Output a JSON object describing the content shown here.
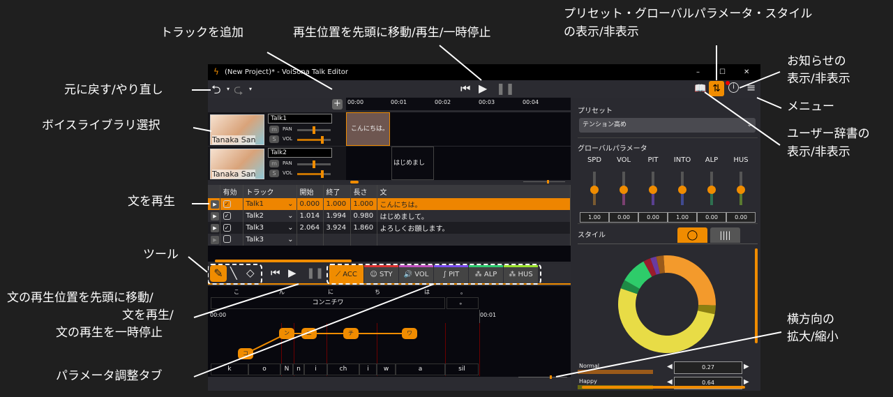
{
  "annotations": {
    "add_track": "トラックを追加",
    "transport": "再生位置を先頭に移動/再生/一時停止",
    "preset_toggle_1": "プリセット・グローバルパラメータ・スタイル",
    "preset_toggle_2": "の表示/非表示",
    "notice_1": "お知らせの",
    "notice_2": "表示/非表示",
    "menu": "メニュー",
    "dict_1": "ユーザー辞書の",
    "dict_2": "表示/非表示",
    "undo_redo": "元に戻す/やり直し",
    "voice_select": "ボイスライブラリ選択",
    "play_sentence": "文を再生",
    "tools": "ツール",
    "sentence_transport_1": "文の再生位置を先頭に移動/",
    "sentence_transport_2": "文を再生/",
    "sentence_transport_3": "文の再生を一時停止",
    "param_tabs": "パラメータ調整タブ",
    "zoom_1": "横方向の",
    "zoom_2": "拡大/縮小"
  },
  "window": {
    "title": "(New Project)* - VoiSona Talk Editor",
    "min": "–",
    "max": "☐",
    "close": "✕"
  },
  "timeline": {
    "ticks": [
      "00:00",
      "00:01",
      "00:02",
      "00:03",
      "00:04"
    ]
  },
  "tracks": [
    {
      "name": "Talk1",
      "voice": "Tanaka San",
      "m": "m",
      "s": "S",
      "pan": "PAN",
      "vol": "VOL",
      "clip": "こんにちは。"
    },
    {
      "name": "Talk2",
      "voice": "Tanaka San",
      "m": "m",
      "s": "S",
      "pan": "PAN",
      "vol": "VOL",
      "clip": "はじめまして。"
    }
  ],
  "table": {
    "headers": [
      "",
      "有効",
      "トラック",
      "開始",
      "終了",
      "長さ",
      "文"
    ],
    "rows": [
      {
        "track": "Talk1",
        "start": "0.000",
        "end": "1.000",
        "len": "1.000",
        "text": "こんにちは。",
        "enabled": true
      },
      {
        "track": "Talk2",
        "start": "1.014",
        "end": "1.994",
        "len": "0.980",
        "text": "はじめまして。",
        "enabled": true
      },
      {
        "track": "Talk3",
        "start": "2.064",
        "end": "3.924",
        "len": "1.860",
        "text": "よろしくお願します。",
        "enabled": true
      },
      {
        "track": "Talk3",
        "start": "",
        "end": "",
        "len": "",
        "text": "",
        "enabled": false
      }
    ]
  },
  "param_tabs": [
    {
      "label": "ACC",
      "color": "#f08c00"
    },
    {
      "label": "STY",
      "color": "#d33"
    },
    {
      "label": "VOL",
      "color": "#c050c0"
    },
    {
      "label": "PIT",
      "color": "#7a4cf0"
    },
    {
      "label": "ALP",
      "color": "#2ecc71"
    },
    {
      "label": "HUS",
      "color": "#9be22d"
    }
  ],
  "editor": {
    "kana": [
      "こ",
      "ん",
      "に",
      "ち",
      "は",
      "。"
    ],
    "reading": "コンニチワ",
    "reading_punct": "。",
    "time": [
      "00:00",
      "00:01"
    ],
    "nodes": [
      "コ",
      "ン",
      "ニ",
      "チ",
      "ワ"
    ],
    "phonemes": [
      "k",
      "o",
      "N",
      "n",
      "i",
      "ch",
      "i",
      "w",
      "a",
      "sil"
    ]
  },
  "right": {
    "preset_title": "プリセット",
    "preset_value": "テンション高め",
    "global_title": "グローバルパラメータ",
    "params": [
      {
        "label": "SPD",
        "value": "1.00",
        "color": "#7a5a30"
      },
      {
        "label": "VOL",
        "value": "0.00",
        "color": "#7a4070"
      },
      {
        "label": "PIT",
        "value": "0.00",
        "color": "#5a4090"
      },
      {
        "label": "INTO",
        "value": "1.00",
        "color": "#404a90"
      },
      {
        "label": "ALP",
        "value": "0.00",
        "color": "#2e7050"
      },
      {
        "label": "HUS",
        "value": "0.00",
        "color": "#5a7a30"
      }
    ],
    "style_title": "スタイル",
    "style_slices": [
      {
        "value": 27,
        "color": "#f39a2c"
      },
      {
        "value": 3,
        "color": "#8c8010"
      },
      {
        "value": 53,
        "color": "#e8dc46"
      },
      {
        "value": 3,
        "color": "#1e8a45"
      },
      {
        "value": 9,
        "color": "#2ecc6a"
      },
      {
        "value": 2.5,
        "color": "#9a1c2c"
      },
      {
        "value": 2,
        "color": "#6a3aa0"
      },
      {
        "value": 2.5,
        "color": "#9a5a1a"
      }
    ],
    "styles": [
      {
        "name": "Normal",
        "value": "0.27"
      },
      {
        "name": "Happy",
        "value": "0.64"
      }
    ]
  },
  "accent": "#f08c00"
}
